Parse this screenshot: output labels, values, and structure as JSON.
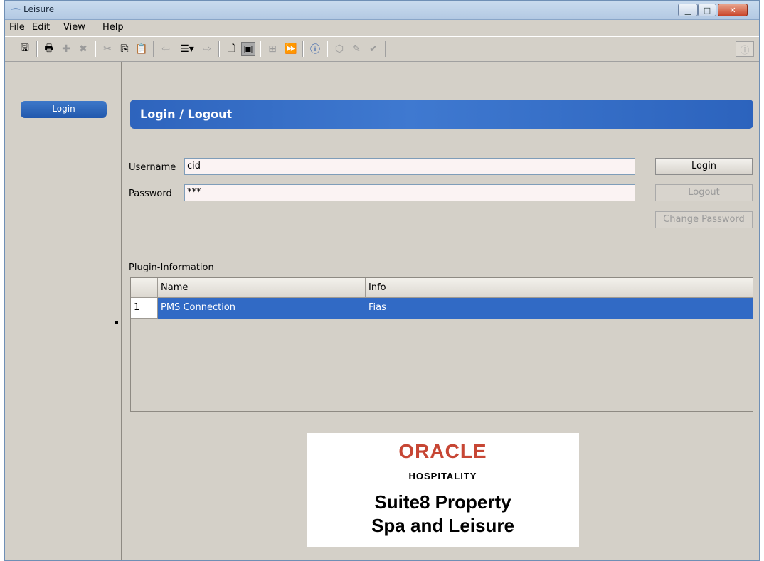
{
  "window": {
    "title": "Leisure"
  },
  "menu": [
    {
      "u": "F",
      "rest": "ile"
    },
    {
      "u": "E",
      "rest": "dit"
    },
    {
      "u": "V",
      "rest": "iew"
    },
    {
      "u": "H",
      "rest": "elp"
    }
  ],
  "toolbar": {
    "icons": [
      "save-icon",
      "print-icon",
      "add-icon",
      "delete-icon",
      "cut-icon",
      "copy-icon",
      "paste-icon",
      "back-icon",
      "list-dropdown-icon",
      "forward-icon",
      "new-page-icon",
      "layout-icon",
      "structure-icon",
      "run-icon",
      "info-icon",
      "tag-icon",
      "note-icon",
      "check-icon"
    ],
    "glyphs": {
      "save": "🖫",
      "print": "🖶",
      "add": "✚",
      "delete": "✖",
      "cut": "✂",
      "copy": "⎘",
      "paste": "📋",
      "back": "⇦",
      "list": "☰▾",
      "forward": "⇨",
      "newpage": "🗋",
      "layout": "▣",
      "structure": "⊞",
      "run": "⏩",
      "info": "ⓘ",
      "tag": "⬡",
      "note": "✎",
      "check": "✔",
      "info_right": "ⓘ"
    }
  },
  "sidebar": {
    "items": [
      {
        "label": "Login"
      }
    ]
  },
  "page": {
    "title": "Login / Logout"
  },
  "form": {
    "username_label": "Username",
    "username_value": "cid",
    "password_label": "Password",
    "password_value": "***"
  },
  "buttons": {
    "login": "Login",
    "logout": "Logout",
    "change_password": "Change Password"
  },
  "plugins": {
    "label": "Plugin-Information",
    "columns": [
      "Name",
      "Info"
    ],
    "rows": [
      {
        "num": "1",
        "name": "PMS Connection",
        "info": "Fias"
      }
    ]
  },
  "logo": {
    "brand": "ORACLE",
    "sub": "HOSPITALITY",
    "line1": "Suite8 Property",
    "line2": "Spa and Leisure"
  },
  "colors": {
    "accent": "#316ac5",
    "header_blue": "#3a72c9",
    "oracle_red": "#c74634"
  }
}
